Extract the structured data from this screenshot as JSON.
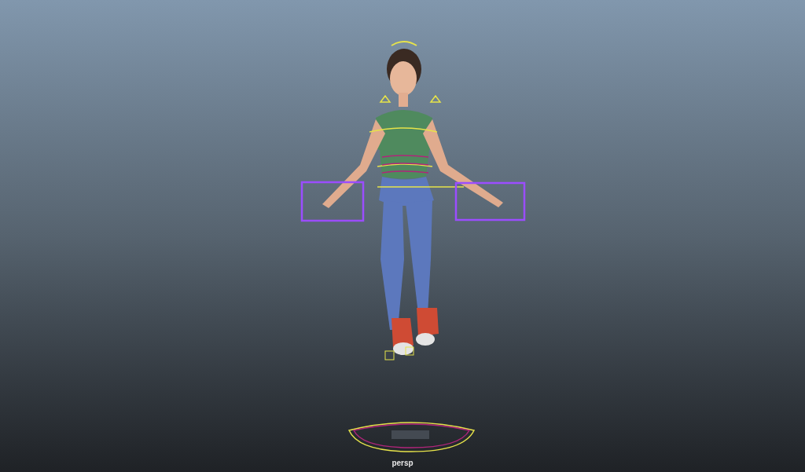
{
  "viewport": {
    "camera_label": "persp"
  }
}
